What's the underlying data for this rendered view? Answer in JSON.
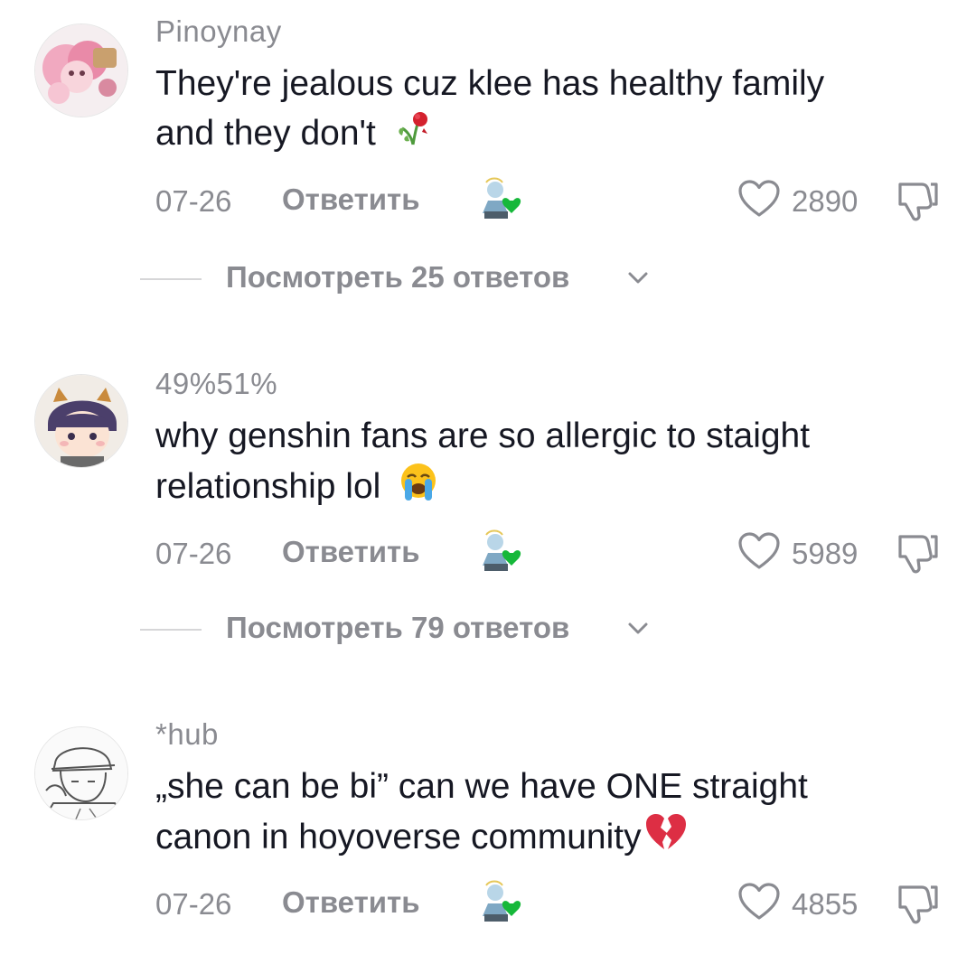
{
  "comments": [
    {
      "username": "Pinoynay",
      "text_line1": "They're jealous cuz klee has healthy family",
      "text_line2": "and they don't",
      "emoji": "wilted-rose-icon",
      "date": "07-26",
      "reply_label": "Ответить",
      "like_count": "2890",
      "view_replies": "Посмотреть 25 ответов"
    },
    {
      "username": "49%51%",
      "text_line1": "why genshin fans are so allergic to staight",
      "text_line2": "relationship lol",
      "emoji": "loudly-crying-face-icon",
      "date": "07-26",
      "reply_label": "Ответить",
      "like_count": "5989",
      "view_replies": "Посмотреть 79 ответов"
    },
    {
      "username": "*hub",
      "text_line1": "„she can be bi” can we have ONE straight",
      "text_line2": "canon in hoyoverse community",
      "emoji": "broken-heart-icon",
      "date": "07-26",
      "reply_label": "Ответить",
      "like_count": "4855"
    }
  ],
  "colors": {
    "text": "#161823",
    "secondary": "#8a8b91",
    "divider": "#d6d6d8",
    "creator_heart": "#16b83a"
  }
}
